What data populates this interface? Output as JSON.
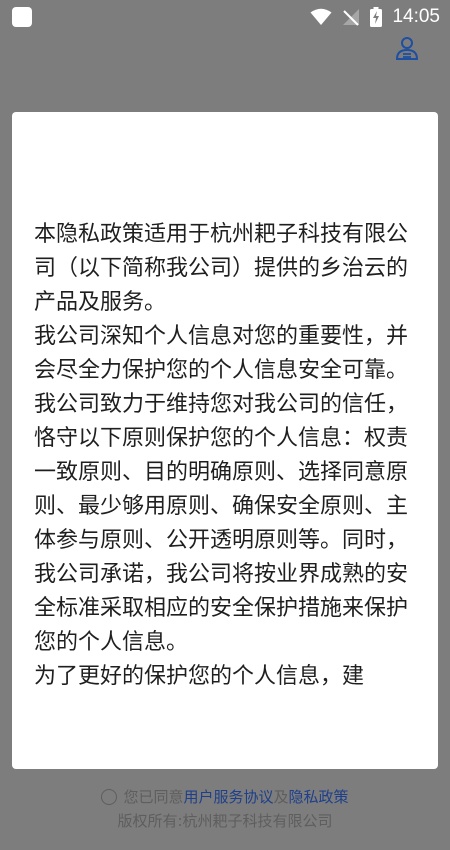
{
  "status_bar": {
    "time": "14:05",
    "icons": [
      "wifi-icon",
      "no-signal-icon",
      "battery-charging-icon"
    ],
    "color": "#ffffff"
  },
  "header": {
    "profile_icon": "user-service-icon",
    "icon_color": "#1e4fa0"
  },
  "dialog": {
    "paragraphs": [
      "本隐私政策适用于杭州耙子科技有限公司（以下简称我公司）提供的乡治云的产品及服务。",
      "我公司深知个人信息对您的重要性，并会尽全力保护您的个人信息安全可靠。我公司致力于维持您对我公司的信任，恪守以下原则保护您的个人信息：权责一致原则、目的明确原则、选择同意原则、最少够用原则、确保安全原则、主体参与原则、公开透明原则等。同时，我公司承诺，我公司将按业界成熟的安全标准采取相应的安全保护措施来保护您的个人信息。",
      "为了更好的保护您的个人信息，建"
    ]
  },
  "footer": {
    "agree_prefix": "您已同意",
    "user_agreement_link": "用户服务协议",
    "and_text": "及",
    "privacy_policy_link": "隐私政策",
    "copyright": "版权所有:杭州耙子科技有限公司",
    "link_color": "#1e3f8a"
  },
  "colors": {
    "overlay_background": "#7d7d7d",
    "dialog_background": "#ffffff",
    "text": "#1f1f1f"
  }
}
